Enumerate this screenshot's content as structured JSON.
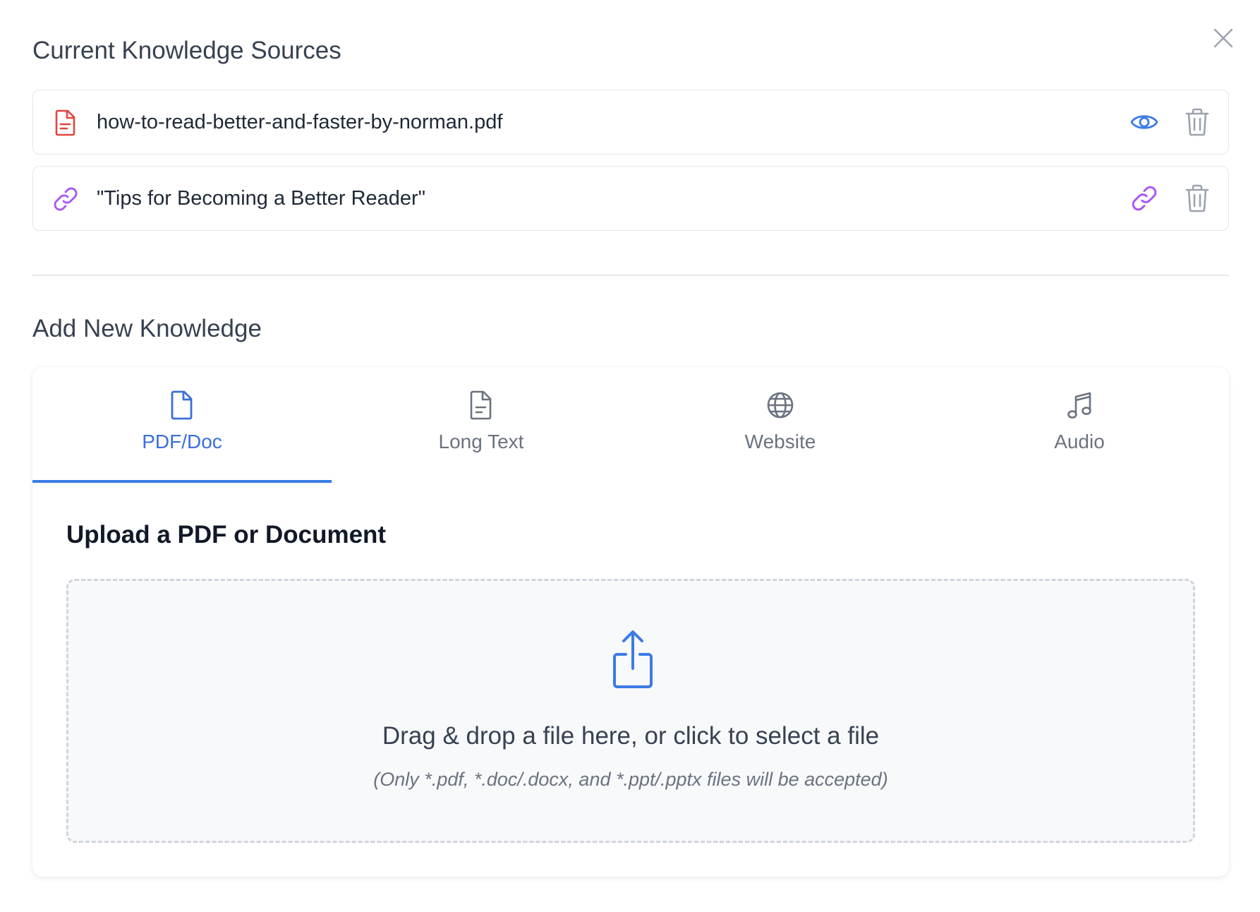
{
  "current_sources": {
    "title": "Current Knowledge Sources",
    "items": [
      {
        "type": "pdf",
        "label": "how-to-read-better-and-faster-by-norman.pdf",
        "action": "view"
      },
      {
        "type": "link",
        "label": "\"Tips for Becoming a Better Reader\"",
        "action": "open-link"
      }
    ]
  },
  "add_knowledge": {
    "title": "Add New Knowledge",
    "tabs": [
      {
        "label": "PDF/Doc",
        "icon": "file-icon",
        "active": true
      },
      {
        "label": "Long Text",
        "icon": "file-text-icon",
        "active": false
      },
      {
        "label": "Website",
        "icon": "globe-icon",
        "active": false
      },
      {
        "label": "Audio",
        "icon": "music-icon",
        "active": false
      }
    ],
    "upload": {
      "title": "Upload a PDF or Document",
      "dropzone_text": "Drag & drop a file here, or click to select a file",
      "accepted_text": "(Only *.pdf, *.doc/.docx, and *.ppt/.pptx files will be accepted)"
    }
  },
  "colors": {
    "accent": "#3b6fd9",
    "pdf_red": "#e0463f",
    "link_purple": "#a855f7",
    "muted": "#6b7280"
  }
}
